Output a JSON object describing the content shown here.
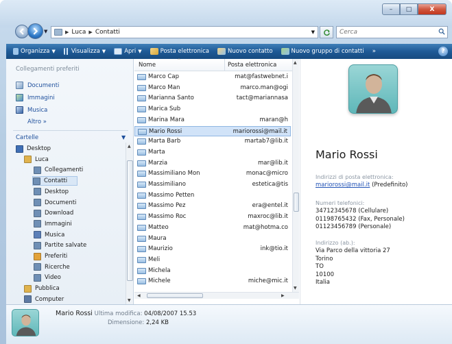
{
  "window": {
    "caption_buttons": {
      "minimize": "–",
      "maximize": "□",
      "close": "X"
    }
  },
  "address_bar": {
    "crumbs": [
      "Luca",
      "Contatti"
    ],
    "search_placeholder": "Cerca"
  },
  "toolbar": {
    "items": [
      {
        "label": "Organizza",
        "icon": "organize-icon",
        "has_arrow": true
      },
      {
        "label": "Visualizza",
        "icon": "views-icon",
        "has_arrow": true
      },
      {
        "label": "Apri",
        "icon": "open-icon",
        "has_arrow": true
      },
      {
        "label": "Posta elettronica",
        "icon": "email-icon",
        "has_arrow": false
      },
      {
        "label": "Nuovo contatto",
        "icon": "new-contact-icon",
        "has_arrow": false
      },
      {
        "label": "Nuovo gruppo di contatti",
        "icon": "new-group-icon",
        "has_arrow": false
      }
    ],
    "more": "»"
  },
  "nav_pane": {
    "favorites_heading": "Collegamenti preferiti",
    "favorites": [
      {
        "label": "Documenti",
        "icon": "documents-icon"
      },
      {
        "label": "Immagini",
        "icon": "pictures-icon"
      },
      {
        "label": "Musica",
        "icon": "music-icon"
      }
    ],
    "more": "Altro  »",
    "folders_heading": "Cartelle",
    "tree": [
      {
        "label": "Desktop",
        "level": 0,
        "icon": "desktop-icon",
        "color": "#3f6fb5"
      },
      {
        "label": "Luca",
        "level": 1,
        "icon": "user-folder-icon",
        "color": "#e0b34d"
      },
      {
        "label": "Collegamenti",
        "level": 2,
        "icon": "folder-icon",
        "color": "#6f8fb5"
      },
      {
        "label": "Contatti",
        "level": 2,
        "icon": "folder-icon",
        "color": "#6f8fb5",
        "selected": true
      },
      {
        "label": "Desktop",
        "level": 2,
        "icon": "folder-icon",
        "color": "#6f8fb5"
      },
      {
        "label": "Documenti",
        "level": 2,
        "icon": "folder-icon",
        "color": "#6f8fb5"
      },
      {
        "label": "Download",
        "level": 2,
        "icon": "folder-icon",
        "color": "#6f8fb5"
      },
      {
        "label": "Immagini",
        "level": 2,
        "icon": "folder-icon",
        "color": "#6f8fb5"
      },
      {
        "label": "Musica",
        "level": 2,
        "icon": "music-folder-icon",
        "color": "#5b7fb8"
      },
      {
        "label": "Partite salvate",
        "level": 2,
        "icon": "folder-icon",
        "color": "#6f8fb5"
      },
      {
        "label": "Preferiti",
        "level": 2,
        "icon": "favorites-folder-icon",
        "color": "#e2a23a"
      },
      {
        "label": "Ricerche",
        "level": 2,
        "icon": "search-folder-icon",
        "color": "#6f8fb5"
      },
      {
        "label": "Video",
        "level": 2,
        "icon": "folder-icon",
        "color": "#6f8fb5"
      },
      {
        "label": "Pubblica",
        "level": 1,
        "icon": "folder-icon",
        "color": "#e0b34d"
      },
      {
        "label": "Computer",
        "level": 1,
        "icon": "computer-icon",
        "color": "#5d7aa3"
      }
    ]
  },
  "file_list": {
    "columns": [
      "Nome",
      "Posta elettronica"
    ],
    "rows": [
      {
        "name": "Marco Cap",
        "email": "mat@fastwebnet.i"
      },
      {
        "name": "Marco Man",
        "email": "marco.man@ogi"
      },
      {
        "name": "Marianna Santo",
        "email": "tact@mariannasa"
      },
      {
        "name": "Marica Sub",
        "email": ""
      },
      {
        "name": "Marina Mara",
        "email": "maran@h"
      },
      {
        "name": "Mario Rossi",
        "email": "mariorossi@mail.it",
        "selected": true
      },
      {
        "name": "Marta Barb",
        "email": "martab7@lib.it"
      },
      {
        "name": "Marta",
        "email": ""
      },
      {
        "name": "Marzia",
        "email": "mar@lib.it"
      },
      {
        "name": "Massimiliano Mon",
        "email": "monac@micro"
      },
      {
        "name": "Massimiliano",
        "email": "estetica@tis"
      },
      {
        "name": "Massimo Petten",
        "email": ""
      },
      {
        "name": "Massimo Pez",
        "email": "era@entel.it"
      },
      {
        "name": "Massimo Roc",
        "email": "maxroc@lib.it"
      },
      {
        "name": "Matteo",
        "email": "mat@hotma.co"
      },
      {
        "name": "Maura",
        "email": ""
      },
      {
        "name": "Maurizio",
        "email": "ink@tio.it"
      },
      {
        "name": "Meli",
        "email": ""
      },
      {
        "name": "Michela",
        "email": ""
      },
      {
        "name": "Michele",
        "email": "miche@mic.it"
      }
    ]
  },
  "preview": {
    "name": "Mario Rossi",
    "email_label": "Indirizzi di posta elettronica:",
    "email": "mariorossi@mail.it",
    "email_suffix": "(Predefinito)",
    "phone_label": "Numeri telefonici:",
    "phones": [
      "34712345678 (Cellulare)",
      "01198765432 (Fax, Personale)",
      "01123456789 (Personale)"
    ],
    "address_label": "Indirizzo (ab.):",
    "address_lines": [
      "Via Parco della vittoria 27",
      "Torino",
      "TO",
      "10100",
      "Italia"
    ]
  },
  "details": {
    "name": "Mario Rossi",
    "modified_label": "Ultima modifica:",
    "modified_value": "04/08/2007 15.53",
    "size_label": "Dimensione:",
    "size_value": "2,24 KB"
  },
  "colors": {
    "toolbar": "#1e5a96",
    "link": "#1f51b5",
    "selection": "#d1e3f8"
  }
}
